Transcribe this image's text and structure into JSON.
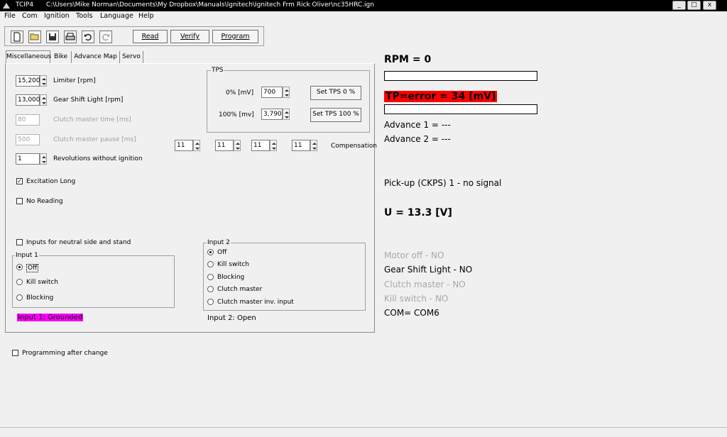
{
  "window": {
    "app_title": "TCIP4",
    "path": "C:\\Users\\Mike Norman\\Documents\\My Dropbox\\Manuals\\Ignitech\\Ignitech Frm Rick Oliver\\nc35HRC.ign",
    "min_label": "_",
    "max_label": "□",
    "close_label": "x"
  },
  "menu": [
    "File",
    "Com",
    "Ignition",
    "Tools",
    "Language",
    "Help"
  ],
  "toolbar": {
    "icons": [
      "new-file-icon",
      "open-folder-icon",
      "save-icon",
      "print-icon",
      "undo-icon",
      "redo-icon"
    ],
    "read_label": "Read",
    "verify_label": "Verify",
    "program_label": "Program"
  },
  "tabs": [
    "Miscellaneous",
    "Bike",
    "Advance Map",
    "Servo"
  ],
  "misc": {
    "limiter": {
      "value": "15,200",
      "label": "Limiter [rpm]"
    },
    "gear_shift": {
      "value": "13,000",
      "label": "Gear Shift Light [rpm]"
    },
    "clutch_time": {
      "value": "80",
      "label": "Clutch master time [ms]"
    },
    "clutch_pause": {
      "value": "500",
      "label": "Clutch master pause [ms]"
    },
    "revolutions": {
      "value": "1",
      "label": "Revolutions without ignition"
    },
    "excitation_long": {
      "label": "Excitation Long",
      "checked": true
    },
    "no_reading": {
      "label": "No Reading",
      "checked": false
    },
    "tps": {
      "title": "TPS",
      "row0_label": "0% [mV]",
      "row0_value": "700",
      "row0_button": "Set TPS 0 %",
      "row100_label": "100% [mv]",
      "row100_value": "3,790",
      "row100_button": "Set TPS 100 %"
    },
    "compensation": {
      "values": [
        "11",
        "11",
        "11",
        "11"
      ],
      "label": "Compensation"
    },
    "inputs_neutral": {
      "label": "Inputs for neutral side and stand",
      "checked": false
    },
    "input1": {
      "title": "Input 1",
      "options": [
        "Off",
        "Kill switch",
        "Blocking"
      ],
      "selected": 0,
      "status": "Input 1: Grounded",
      "status_color": "#ff00ff"
    },
    "input2": {
      "title": "Input 2",
      "options": [
        "Off",
        "Kill switch",
        "Blocking",
        "Clutch master",
        "Clutch master inv. input"
      ],
      "selected": 0,
      "status": "Input 2: Open"
    },
    "programming_after_change": {
      "label": "Programming after change",
      "checked": false
    }
  },
  "status": {
    "rpm": "RPM = 0",
    "tp": "TP=error = 34 [mV]",
    "tp_color": "#ff0000",
    "advance1": "Advance 1 = ---",
    "advance2": "Advance 2 = ---",
    "pickup": "Pick-up (CKPS) 1 - no signal",
    "voltage": "U = 13.3 [V]",
    "motor_off": "Motor off - NO",
    "gear_shift": "Gear Shift Light - NO",
    "clutch_master": "Clutch master - NO",
    "kill_switch": "Kill switch - NO",
    "com": "COM= COM6"
  }
}
